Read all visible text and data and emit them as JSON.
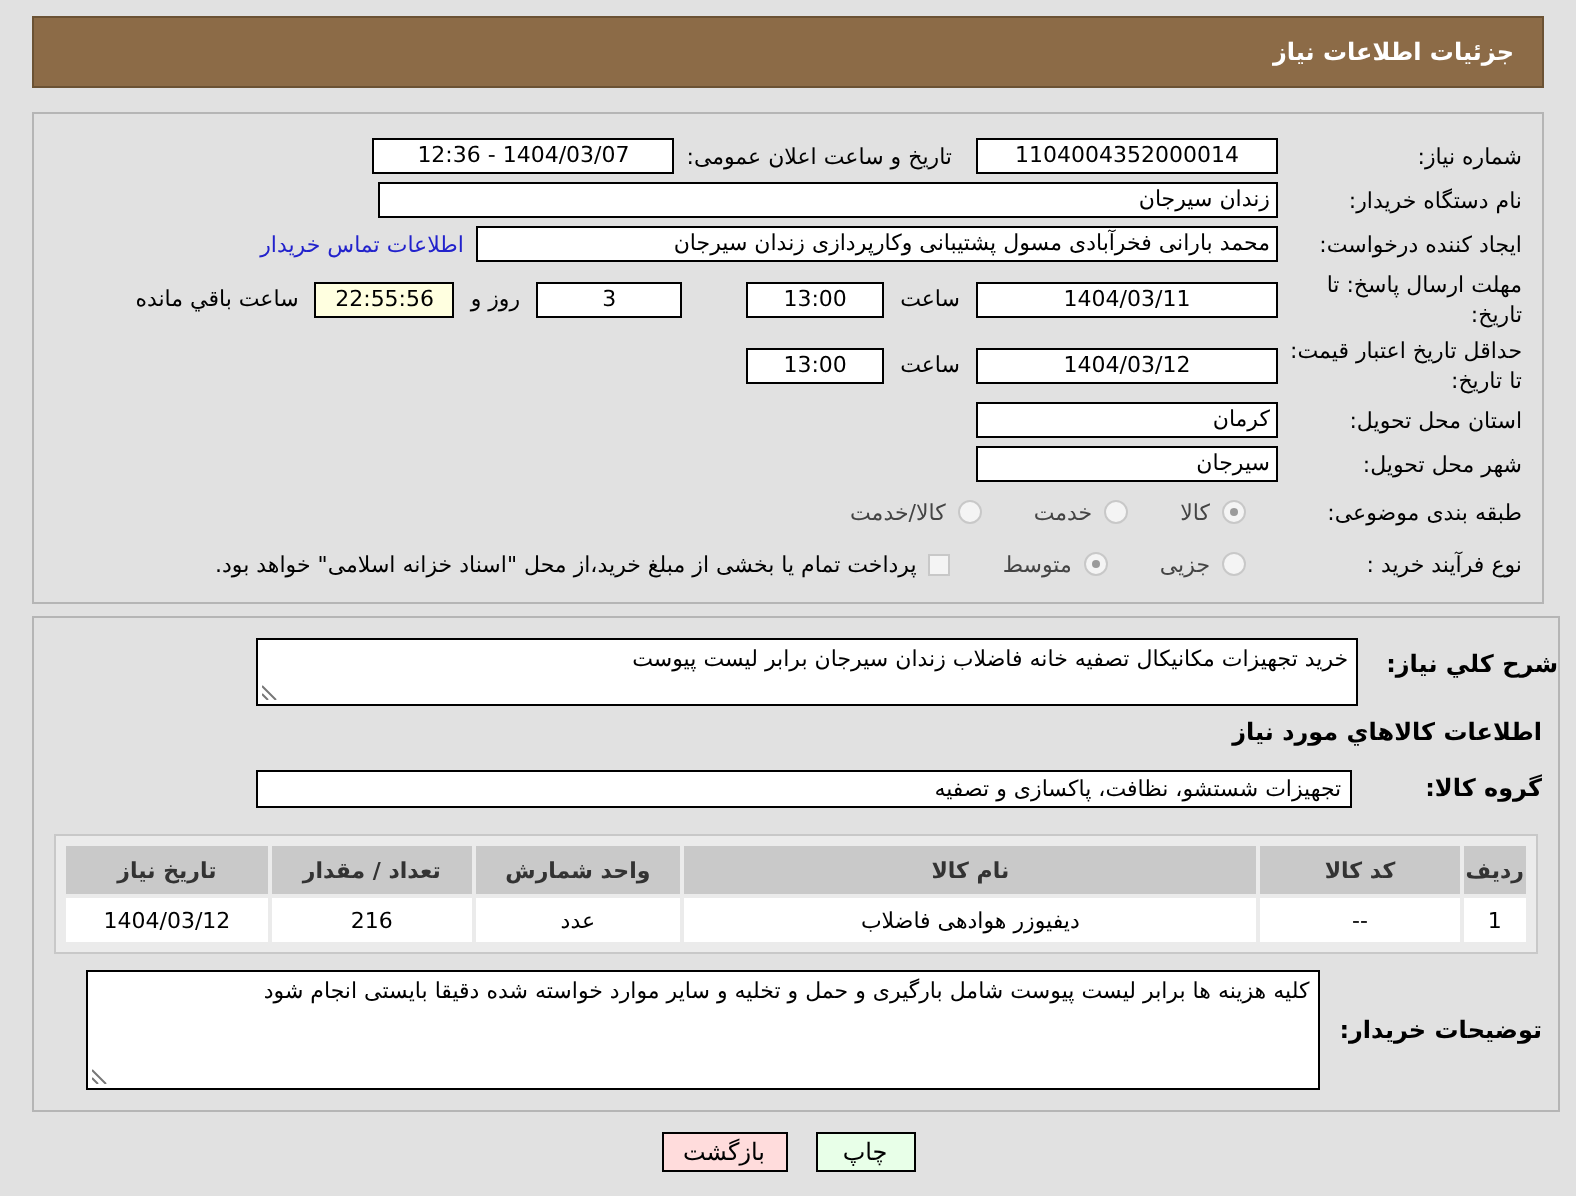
{
  "header": {
    "title": "جزئیات اطلاعات نیاز"
  },
  "need_number": {
    "label": "شماره نیاز:",
    "value": "1104004352000014"
  },
  "announce": {
    "label": "تاریخ و ساعت اعلان عمومی:",
    "value": "1404/03/07 - 12:36"
  },
  "buyer_org": {
    "label": "نام دستگاه خریدار:",
    "value": "زندان سیرجان"
  },
  "requester": {
    "label": "ایجاد کننده درخواست:",
    "value": "محمد بارانی فخرآبادی مسول پشتیبانی وکارپردازی زندان سیرجان",
    "link": "اطلاعات تماس خریدار"
  },
  "reply_deadline": {
    "label": "مهلت ارسال پاسخ: تا تاریخ:",
    "date": "1404/03/11",
    "time_label": "ساعت",
    "time": "13:00",
    "days": "3",
    "days_label": "روز و",
    "remaining": "22:55:56",
    "remaining_label": "ساعت باقي مانده"
  },
  "price_validity": {
    "label": "حداقل تاریخ اعتبار قیمت: تا تاریخ:",
    "date": "1404/03/12",
    "time_label": "ساعت",
    "time": "13:00"
  },
  "province": {
    "label": "استان محل تحویل:",
    "value": "کرمان"
  },
  "city": {
    "label": "شهر محل تحویل:",
    "value": "سیرجان"
  },
  "category": {
    "label": "طبقه بندی موضوعی:",
    "options": [
      {
        "label": "کالا",
        "selected": true
      },
      {
        "label": "خدمت",
        "selected": false
      },
      {
        "label": "کالا/خدمت",
        "selected": false
      }
    ]
  },
  "process": {
    "label": "نوع فرآیند خرید :",
    "options": [
      {
        "label": "جزیی",
        "selected": false
      },
      {
        "label": "متوسط",
        "selected": true
      }
    ],
    "checkbox": {
      "label": "پرداخت تمام یا بخشی از مبلغ خرید،از محل \"اسناد خزانه اسلامی\" خواهد بود.",
      "checked": false
    }
  },
  "description": {
    "label": "شرح کلي نیاز:",
    "value": "خرید تجهیزات مکانیکال  تصفیه خانه فاضلاب زندان سیرجان برابر لیست پیوست"
  },
  "items_heading": "اطلاعات کالاهاي مورد نیاز",
  "goods_group": {
    "label": "گروه کالا:",
    "value": "تجهیزات شستشو، نظافت، پاکسازی و تصفیه"
  },
  "table": {
    "columns": [
      "ردیف",
      "کد کالا",
      "نام کالا",
      "واحد شمارش",
      "تعداد / مقدار",
      "تاریخ نیاز"
    ],
    "rows": [
      [
        "1",
        "--",
        "دیفیوزر هوادهی فاضلاب",
        "عدد",
        "216",
        "1404/03/12"
      ]
    ]
  },
  "buyer_notes": {
    "label": "توضیحات خریدار:",
    "value": "کلیه هزینه ها برابر لیست پیوست شامل بارگیری و حمل و تخلیه و سایر موارد خواسته شده دقیقا بایستی انجام شود"
  },
  "buttons": [
    {
      "label": "چاپ",
      "kind": "print"
    },
    {
      "label": "بازگشت",
      "kind": "back"
    }
  ]
}
